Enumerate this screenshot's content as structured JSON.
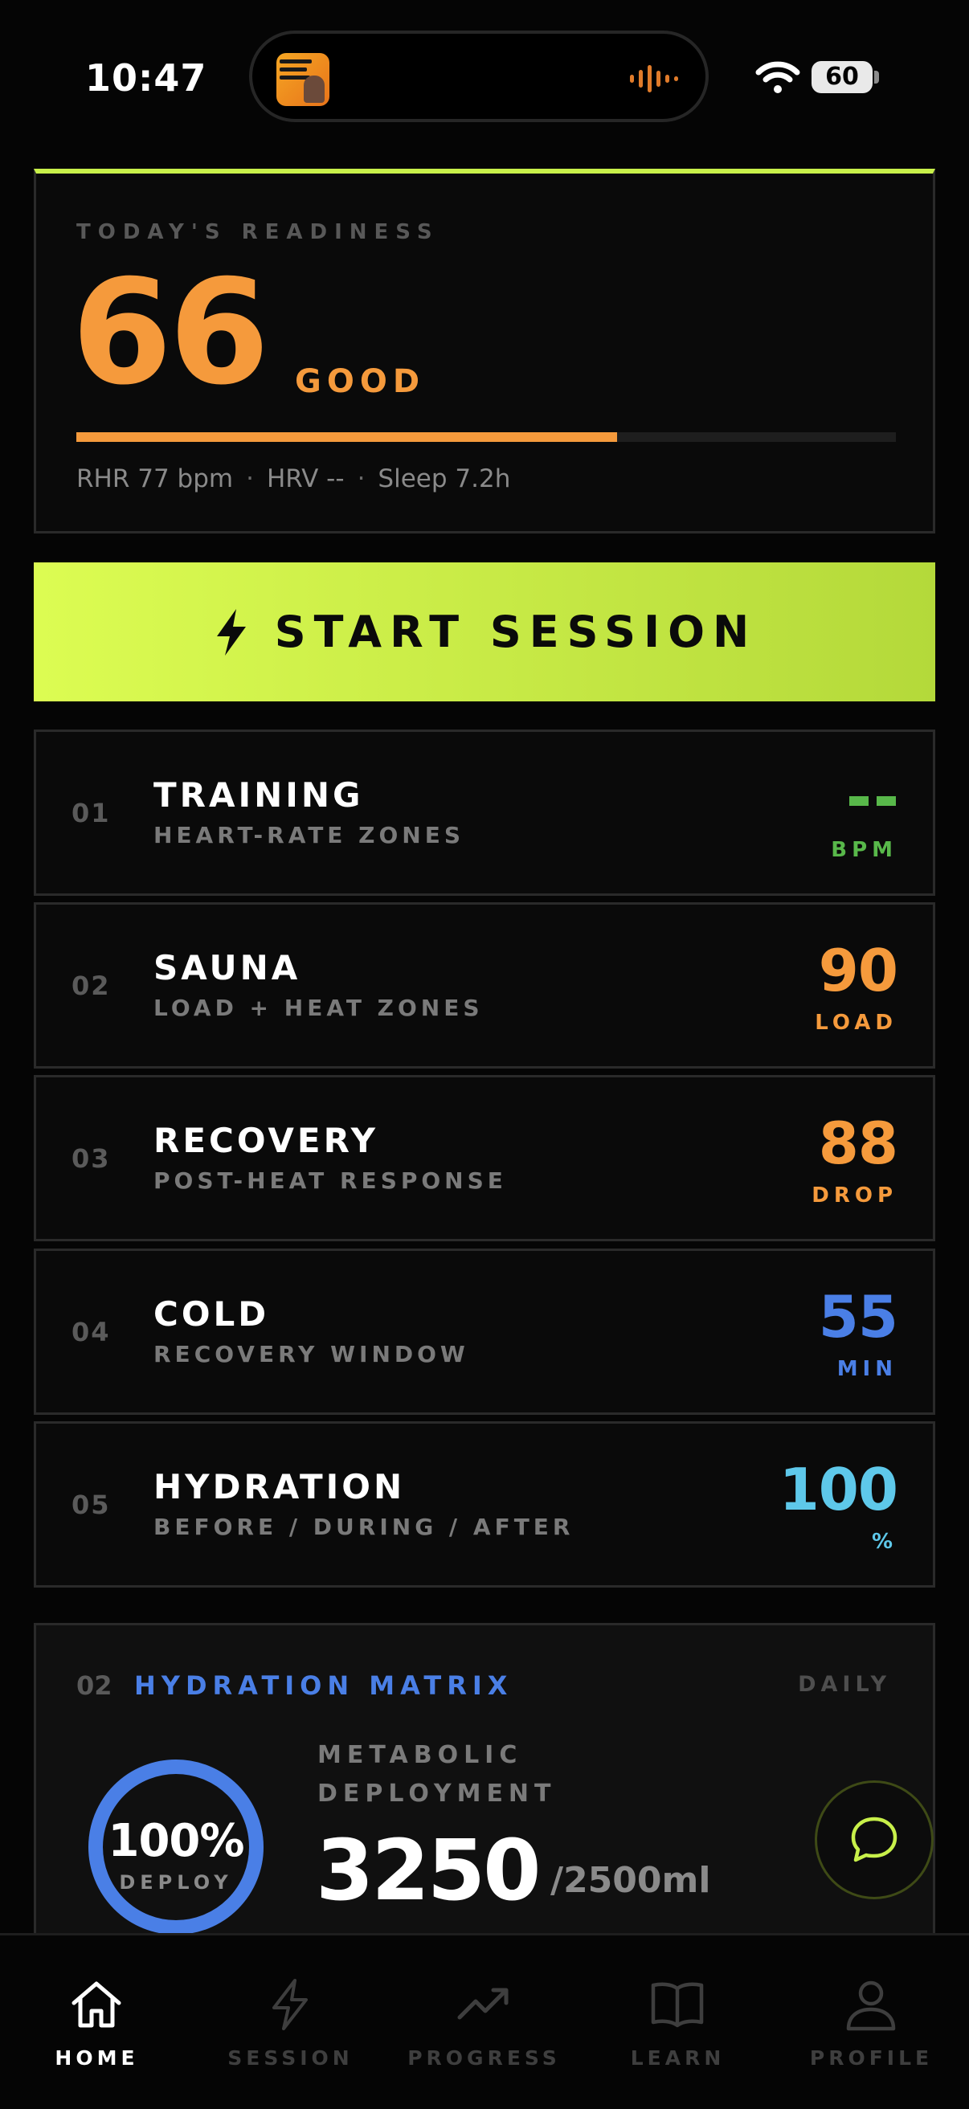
{
  "status_bar": {
    "time": "10:47",
    "battery": "60"
  },
  "readiness": {
    "label": "TODAY'S READINESS",
    "score": "66",
    "status": "GOOD",
    "progress": 0.66,
    "metrics": [
      "RHR 77 bpm",
      "HRV --",
      "Sleep 7.2h"
    ],
    "separator": "·"
  },
  "start_button": {
    "label": "START SESSION"
  },
  "modules": [
    {
      "num": "01",
      "title": "TRAINING",
      "subtitle": "HEART-RATE ZONES",
      "value": "--",
      "unit": "BPM",
      "color": "#58b84a"
    },
    {
      "num": "02",
      "title": "SAUNA",
      "subtitle": "LOAD + HEAT ZONES",
      "value": "90",
      "unit": "LOAD",
      "color": "#f59a3c"
    },
    {
      "num": "03",
      "title": "RECOVERY",
      "subtitle": "POST-HEAT RESPONSE",
      "value": "88",
      "unit": "DROP",
      "color": "#f59a3c"
    },
    {
      "num": "04",
      "title": "COLD",
      "subtitle": "RECOVERY WINDOW",
      "value": "55",
      "unit": "MIN",
      "color": "#4a7fe6"
    },
    {
      "num": "05",
      "title": "HYDRATION",
      "subtitle": "BEFORE / DURING / AFTER",
      "value": "100",
      "unit": "%",
      "color": "#5ec8ea"
    }
  ],
  "hydration_matrix": {
    "num": "02",
    "title": "HYDRATION MATRIX",
    "period": "DAILY",
    "ring_percent": "100%",
    "ring_label": "DEPLOY",
    "ring_progress": 1.0,
    "metric_label": "METABOLIC DEPLOYMENT",
    "value": "3250",
    "target": "/2500ml"
  },
  "tabs": [
    {
      "label": "HOME",
      "icon": "home-icon",
      "active": true
    },
    {
      "label": "SESSION",
      "icon": "bolt-icon",
      "active": false
    },
    {
      "label": "PROGRESS",
      "icon": "trend-icon",
      "active": false
    },
    {
      "label": "LEARN",
      "icon": "book-icon",
      "active": false
    },
    {
      "label": "PROFILE",
      "icon": "user-icon",
      "active": false
    }
  ],
  "colors": {
    "accent_lime": "#c8f04a",
    "accent_orange": "#f59a3c",
    "accent_blue": "#4a7fe6",
    "accent_green": "#58b84a",
    "accent_cyan": "#5ec8ea"
  }
}
